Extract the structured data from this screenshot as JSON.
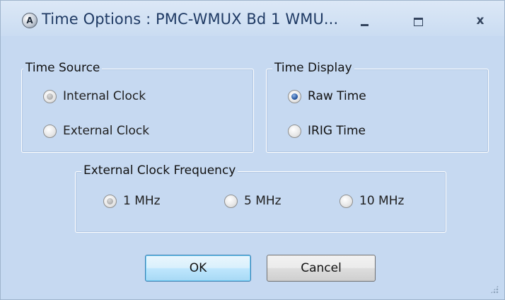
{
  "window": {
    "title": "Time Options : PMC-WMUX Bd 1 WMU...",
    "icon": "app-logo-icon",
    "icon_glyph": "A",
    "controls": {
      "minimize": "_",
      "maximize": "□",
      "close": "x"
    }
  },
  "time_source": {
    "legend": "Time Source",
    "options": [
      {
        "label": "Internal Clock",
        "checked": true,
        "enabled": false
      },
      {
        "label": "External Clock",
        "checked": false,
        "enabled": false
      }
    ]
  },
  "time_display": {
    "legend": "Time Display",
    "options": [
      {
        "label": "Raw Time",
        "checked": true,
        "enabled": true
      },
      {
        "label": "IRIG Time",
        "checked": false,
        "enabled": true
      }
    ]
  },
  "external_clock_frequency": {
    "legend": "External Clock Frequency",
    "options": [
      {
        "label": "1 MHz",
        "checked": true,
        "enabled": false
      },
      {
        "label": "5 MHz",
        "checked": false,
        "enabled": false
      },
      {
        "label": "10 MHz",
        "checked": false,
        "enabled": false
      }
    ]
  },
  "buttons": {
    "ok": "OK",
    "cancel": "Cancel"
  },
  "colors": {
    "window_bg": "#c6d9f1",
    "title_text": "#1f3a64",
    "radio_selected": "#1e4f9a",
    "default_button_border": "#3c7fb1"
  }
}
